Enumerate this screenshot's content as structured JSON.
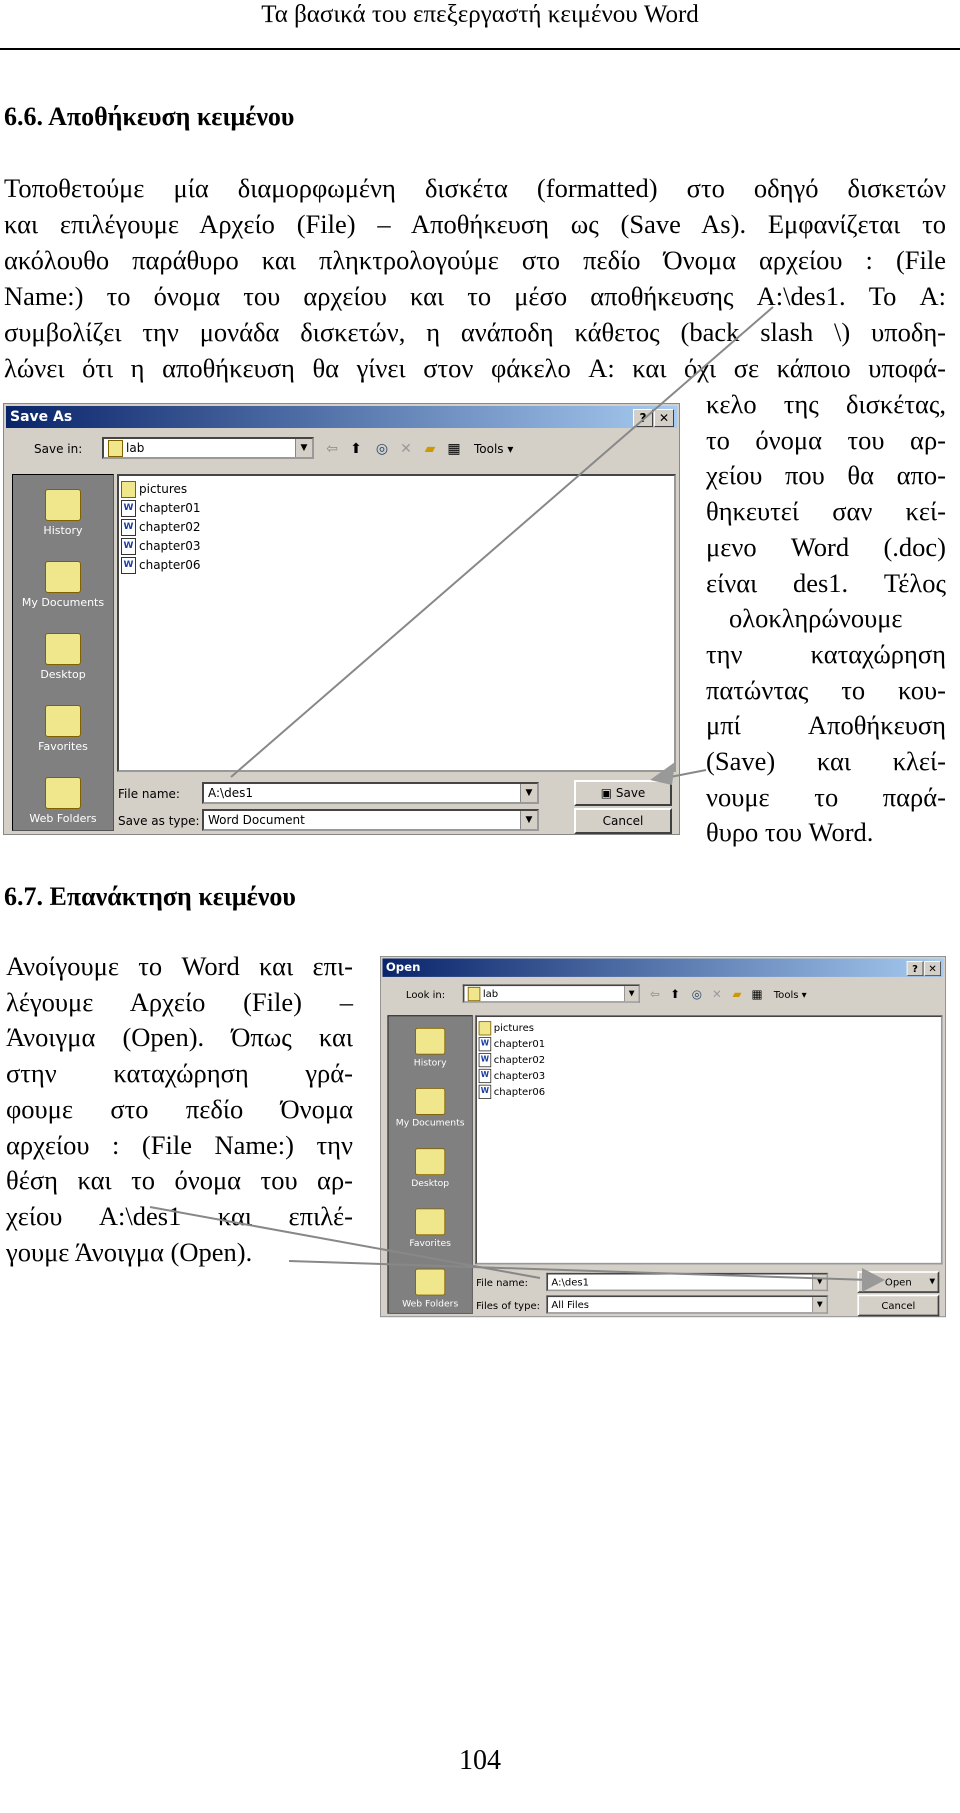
{
  "header": {
    "title": "Τα βασικά του επεξεργαστή κειμένου Word"
  },
  "section1": {
    "heading": "6.6. Αποθήκευση κειμένου",
    "lines": [
      "Τοποθετούμε μία διαμορφωμένη δισκέτα (formatted) στο οδηγό δισκετών",
      "και επιλέγουμε Αρχείο (File) – Αποθήκευση ως (Save As). Εμφανίζεται το",
      "ακόλουθο παράθυρο και πληκτρολογούμε στο πεδίο Όνομα αρχείου : (File",
      "Name:)  το όνομα του αρχείου και το μέσο αποθήκευσης A:\\des1. Το A:",
      "συμβολίζει την μονάδα δισκετών, η ανάποδη κάθετος (back slash \\) υποδη-",
      "λώνει ότι η αποθήκευση θα γίνει στον φάκελο A: και όχι σε κάποιο υποφά-"
    ],
    "side_lines": [
      "κελο της δισκέτας,",
      "το όνομα του αρ-",
      "χείου που θα απο-",
      "θηκευτεί σαν κεί-",
      "μενο Word (.doc)",
      "είναι des1. Τέλος",
      "ολοκληρώνουμε",
      "την καταχώρηση",
      "πατώντας το κου-",
      "μπί Αποθήκευση",
      "(Save) και κλεί-",
      "νουμε το παρά-",
      "θυρο του Word."
    ]
  },
  "section2": {
    "heading": "6.7. Επανάκτηση κειμένου",
    "lines": [
      "Ανοίγουμε το Word και επι-",
      "λέγουμε Αρχείο (File) –",
      "Άνοιγμα (Open). Όπως και",
      "στην καταχώρηση γρά-",
      "φουμε στο πεδίο Όνομα",
      "αρχείου : (File Name:) την",
      "θέση και το όνομα του αρ-",
      "χείου A:\\des1 και επιλέ-",
      "γουμε Άνοιγμα (Open)."
    ]
  },
  "save_dialog": {
    "title": "Save As",
    "location_label": "Save in:",
    "location": "lab",
    "tools": "Tools",
    "places": [
      "History",
      "My Documents",
      "Desktop",
      "Favorites",
      "Web Folders"
    ],
    "files": [
      {
        "name": "pictures",
        "type": "folder"
      },
      {
        "name": "chapter01",
        "type": "word"
      },
      {
        "name": "chapter02",
        "type": "word"
      },
      {
        "name": "chapter03",
        "type": "word"
      },
      {
        "name": "chapter06",
        "type": "word"
      }
    ],
    "filename_label": "File name:",
    "filename": "A:\\des1",
    "type_label": "Save as type:",
    "type": "Word Document",
    "primary": "Save",
    "cancel": "Cancel"
  },
  "open_dialog": {
    "title": "Open",
    "location_label": "Look in:",
    "location": "lab",
    "tools": "Tools",
    "places": [
      "History",
      "My Documents",
      "Desktop",
      "Favorites",
      "Web Folders"
    ],
    "files": [
      {
        "name": "pictures",
        "type": "folder"
      },
      {
        "name": "chapter01",
        "type": "word"
      },
      {
        "name": "chapter02",
        "type": "word"
      },
      {
        "name": "chapter03",
        "type": "word"
      },
      {
        "name": "chapter06",
        "type": "word"
      }
    ],
    "filename_label": "File name:",
    "filename": "A:\\des1",
    "type_label": "Files of type:",
    "type": "All Files",
    "primary": "Open",
    "cancel": "Cancel"
  },
  "page_number": "104"
}
